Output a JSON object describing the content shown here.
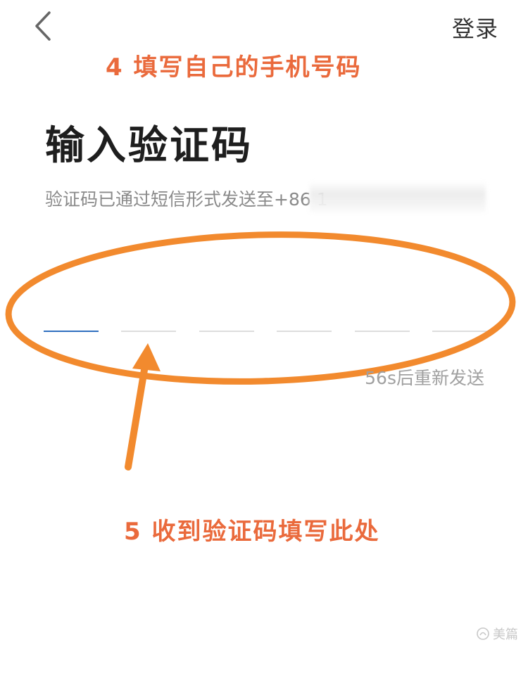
{
  "header": {
    "back_icon": "chevron-left-icon",
    "login_label": "登录"
  },
  "annotations": {
    "step4": "4 填写自己的手机号码",
    "step5": "5 收到验证码填写此处",
    "color": "#f28a2e",
    "text_color": "#ea6a3c"
  },
  "main": {
    "title": "输入验证码",
    "subtitle_prefix": "验证码已通过短信形式发送至",
    "phone_visible": "+86 1",
    "code_slot_count": 6,
    "active_slot_color": "#2f6fbf",
    "resend_text": "56s后重新发送"
  },
  "watermark": {
    "text": "美篇"
  }
}
